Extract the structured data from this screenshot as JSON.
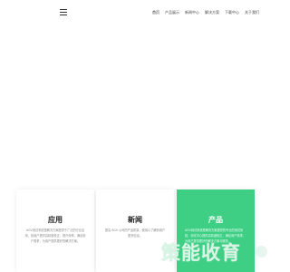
{
  "nav": {
    "items": [
      "首页",
      "产品展示",
      "新闻中心",
      "解决方案",
      "下载中心",
      "关于我们"
    ]
  },
  "cards": [
    {
      "title": "应用",
      "text": "AGV测试系统是解决方案提供于广泛的行业应用，给用户提供高精度校正、提升效率，满足用户需求，为用户提供更好的解决方案。"
    },
    {
      "title": "新闻",
      "text": "提高 AGV 公司的产品质量，使用以了解到用户更多信息。"
    },
    {
      "title": "产品",
      "text": "AGV测试系统是解决方案提供的专业的测试系统，测试中心提供高精度校正，满足用户需求，为用户提供更好的解决方案与服务。"
    }
  ],
  "watermark": {
    "text": "策能收育"
  },
  "colors": {
    "accent": "#3ecf85"
  }
}
